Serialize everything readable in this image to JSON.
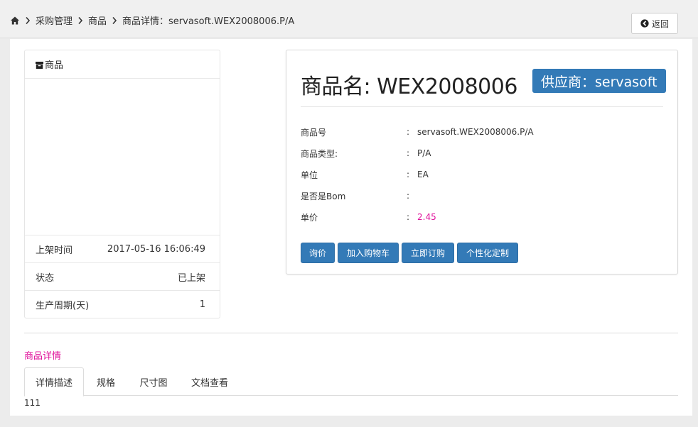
{
  "breadcrumb": {
    "items": [
      "采购管理",
      "商品",
      "商品详情：servasoft.WEX2008006.P/A"
    ]
  },
  "header": {
    "back_label": "返回"
  },
  "left_card": {
    "title": "商品",
    "rows": [
      {
        "label": "上架时间",
        "value": "2017-05-16 16:06:49"
      },
      {
        "label": "状态",
        "value": "已上架"
      },
      {
        "label": "生产周期(天)",
        "value": "1"
      }
    ]
  },
  "product": {
    "name": "商品名: WEX2008006",
    "supplier": "供应商：servasoft",
    "attributes": [
      {
        "label": "商品号",
        "colon": ":",
        "value": "servasoft.WEX2008006.P/A"
      },
      {
        "label": "商品类型:",
        "colon": ":",
        "value": "P/A"
      },
      {
        "label": "单位",
        "colon": ":",
        "value": "EA"
      },
      {
        "label": "是否是Bom",
        "colon": ":",
        "value": ""
      },
      {
        "label": "单价",
        "colon": ":",
        "value": "2.45"
      }
    ],
    "price_color": "#e0139c",
    "buttons": [
      "询价",
      "加入购物车",
      "立即订购",
      "个性化定制"
    ]
  },
  "details": {
    "title": "商品详情",
    "tabs": [
      "详情描述",
      "规格",
      "尺寸图",
      "文档查看"
    ],
    "active_tab": 0,
    "content": "111"
  },
  "colors": {
    "accent": "#337ab7",
    "highlight": "#e0139c"
  }
}
